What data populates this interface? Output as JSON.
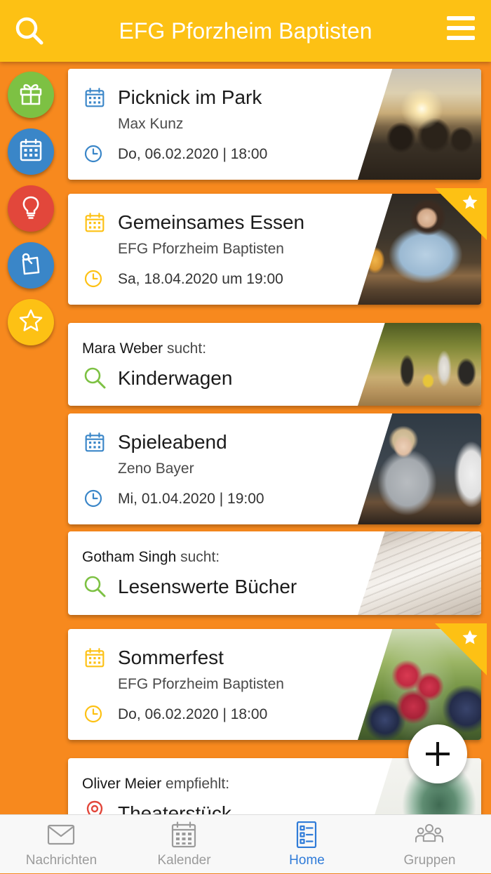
{
  "header": {
    "title": "EFG Pforzheim Baptisten",
    "search_icon": "search-icon",
    "menu_icon": "hamburger-menu-icon"
  },
  "colors": {
    "header": "#FDC114",
    "background": "#F7891E",
    "blue": "#3A86C8",
    "yellow": "#FDC114",
    "green": "#7DC143",
    "red": "#E2473B",
    "nav_active": "#2F7BD8",
    "nav_inactive": "#9B9B9B"
  },
  "side_menu": [
    {
      "icon": "gift-icon",
      "color": "#7DC143"
    },
    {
      "icon": "calendar-icon",
      "color": "#3A86C8"
    },
    {
      "icon": "lightbulb-icon",
      "color": "#E2473B"
    },
    {
      "icon": "pinned-note-icon",
      "color": "#3A86C8"
    },
    {
      "icon": "star-icon",
      "color": "#FDC114"
    }
  ],
  "cards": [
    {
      "title": "Picknick im Park",
      "organizer": "Max Kunz",
      "datetime": "Do, 06.02.2020 | 18:00",
      "icon_color": "#3A86C8",
      "starred": false
    },
    {
      "title": "Gemeinsames Essen",
      "organizer": "EFG Pforzheim Baptisten",
      "datetime": "Sa, 18.04.2020 um 19:00",
      "icon_color": "#FDC114",
      "starred": true
    },
    {
      "person": "Mara Weber",
      "verb": "sucht:",
      "item": "Kinderwagen",
      "icon": "search-icon",
      "icon_color": "#7DC143"
    },
    {
      "title": "Spieleabend",
      "organizer": "Zeno Bayer",
      "datetime": "Mi, 01.04.2020 | 19:00",
      "icon_color": "#3A86C8",
      "starred": false
    },
    {
      "person": "Gotham Singh",
      "verb": "sucht:",
      "item": "Lesenswerte Bücher",
      "icon": "search-icon",
      "icon_color": "#7DC143"
    },
    {
      "title": "Sommerfest",
      "organizer": "EFG Pforzheim Baptisten",
      "datetime": "Do, 06.02.2020 | 18:00",
      "icon_color": "#FDC114",
      "starred": true
    },
    {
      "person": "Oliver Meier",
      "verb": "empfiehlt:",
      "item": "Theaterstück",
      "icon": "map-pin-icon",
      "icon_color": "#E2473B"
    }
  ],
  "fab": {
    "icon": "plus-icon"
  },
  "bottom_nav": {
    "items": [
      {
        "label": "Nachrichten",
        "icon": "envelope-icon",
        "active": false
      },
      {
        "label": "Kalender",
        "icon": "calendar-icon",
        "active": false
      },
      {
        "label": "Home",
        "icon": "list-icon",
        "active": true
      },
      {
        "label": "Gruppen",
        "icon": "group-icon",
        "active": false
      }
    ]
  }
}
